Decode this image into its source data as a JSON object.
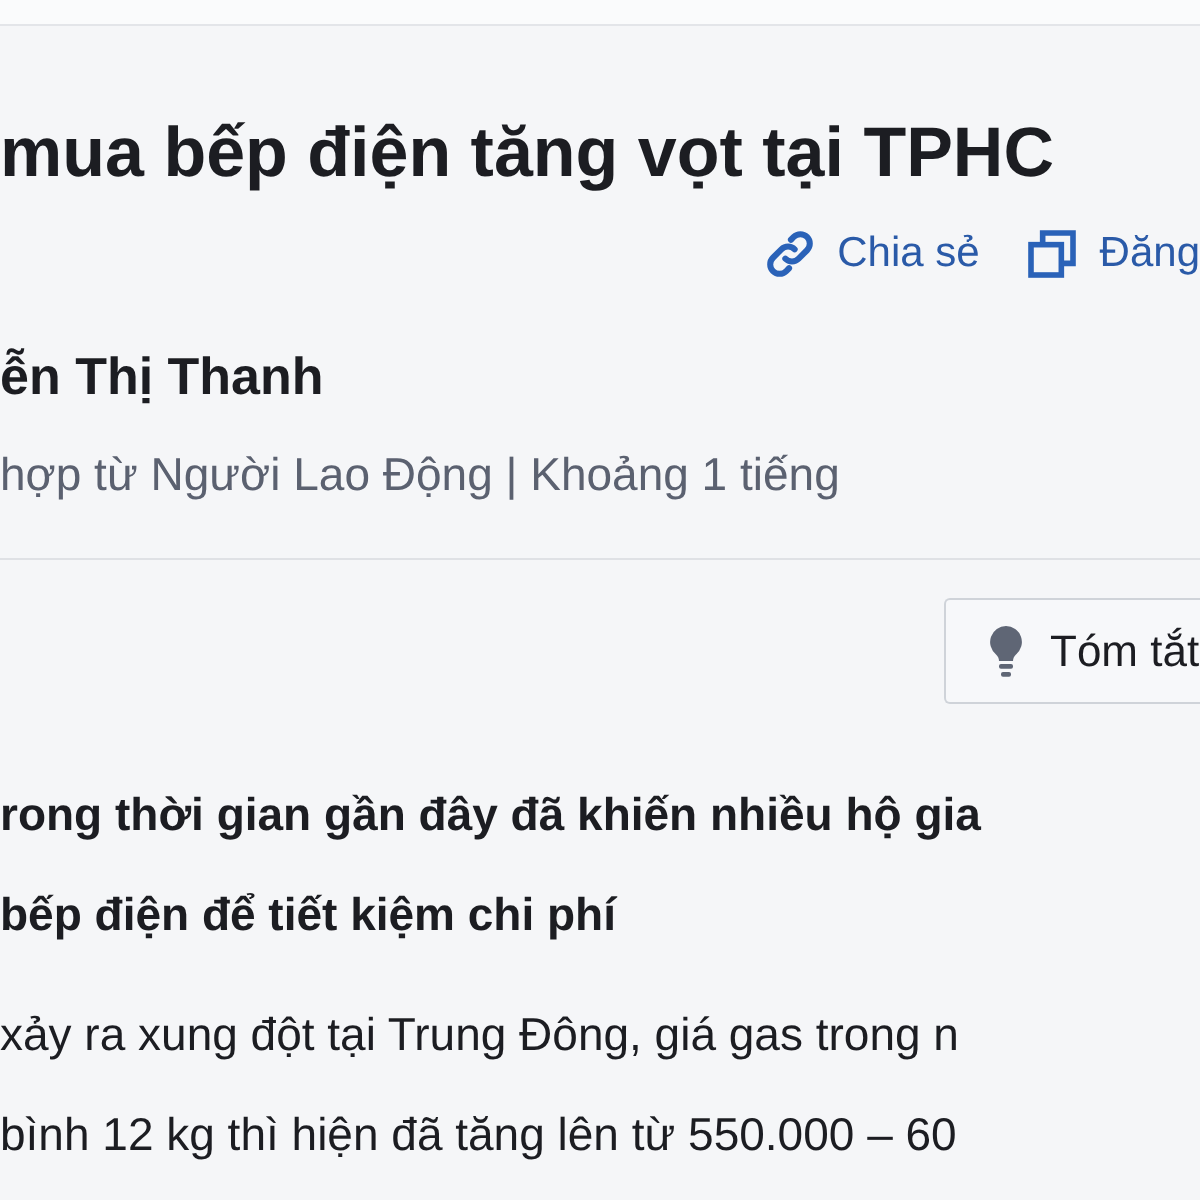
{
  "title": "mua bếp điện tăng vọt tại TPHC",
  "actions": [
    {
      "kind": "link",
      "label": "Chia sẻ"
    },
    {
      "kind": "copy",
      "label": "Đăng"
    }
  ],
  "author": "ễn Thị Thanh",
  "meta": "hợp từ Người Lao Động | Khoảng 1 tiếng",
  "summary_button": "Tóm tắt",
  "lead": [
    "rong thời gian gần đây đã khiến nhiều hộ gia",
    "bếp điện để tiết kiệm chi phí"
  ],
  "body": [
    "xảy ra xung đột tại Trung Đông, giá gas trong n",
    "bình 12 kg thì hiện đã tăng lên từ 550.000 – 60"
  ]
}
